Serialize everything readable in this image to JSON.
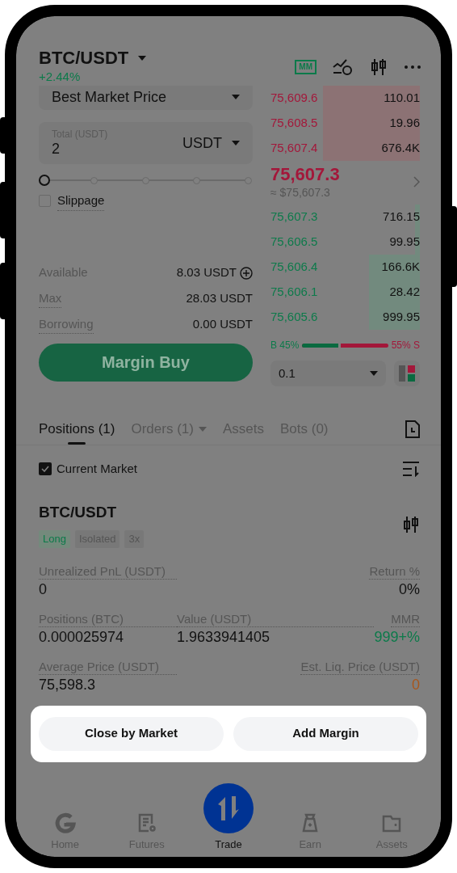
{
  "header": {
    "pair": "BTC/USDT",
    "change": "+2.44%",
    "mm_badge": "MM"
  },
  "order_form": {
    "price_type": "Best Market Price",
    "total": {
      "label": "Total (USDT)",
      "value": "2",
      "unit": "USDT"
    },
    "slider": {
      "level": 0
    },
    "slippage": {
      "label": "Slippage",
      "checked": false
    },
    "stats": [
      {
        "label": "Available",
        "value": "8.03 USDT",
        "kind": "add"
      },
      {
        "label": "Max",
        "value": "28.03 USDT",
        "kind": "plain"
      },
      {
        "label": "Borrowing",
        "value": "0.00 USDT",
        "kind": "plain"
      }
    ],
    "submit": "Margin Buy"
  },
  "order_book": {
    "rows": [
      {
        "price": "75,609.6",
        "amount": "110.01"
      },
      {
        "price": "75,608.5",
        "amount": "19.96"
      },
      {
        "price": "75,607.4",
        "amount": "676.4K"
      }
    ],
    "last_price": "75,607.3",
    "approx": "≈ $75,607.3",
    "bids": [
      {
        "price": "75,607.3",
        "amount": "716.15"
      },
      {
        "price": "75,606.5",
        "amount": "99.95"
      },
      {
        "price": "75,606.4",
        "amount": "166.6K"
      },
      {
        "price": "75,606.1",
        "amount": "28.42"
      },
      {
        "price": "75,605.6",
        "amount": "999.95"
      }
    ],
    "ratio": {
      "buy_label": "B 45%",
      "sell_label": "55% S",
      "level": 0.45
    },
    "precision": "0.1"
  },
  "tabs": [
    {
      "label": "Positions (1)",
      "selected": true,
      "dropdown": false
    },
    {
      "label": "Orders (1)",
      "selected": false,
      "dropdown": true
    },
    {
      "label": "Assets",
      "selected": false,
      "dropdown": false
    },
    {
      "label": "Bots (0)",
      "selected": false,
      "dropdown": false
    }
  ],
  "filter": {
    "label": "Current Market",
    "checked": true
  },
  "position": {
    "pair": "BTC/USDT",
    "tags": [
      {
        "label": "Long",
        "kind": "side"
      },
      {
        "label": "Isolated",
        "kind": "plain"
      },
      {
        "label": "3x",
        "kind": "plain"
      }
    ],
    "fields": [
      [
        {
          "label": "Unrealized PnL (USDT)",
          "value": "0",
          "kind": "plain"
        },
        {
          "label": "Return %",
          "value": "0%",
          "kind": "plain"
        }
      ],
      [
        {
          "label": "Positions (BTC)",
          "value": "0.000025974",
          "kind": "plain"
        },
        {
          "label": "Value (USDT)",
          "value": "1.9633941405",
          "kind": "plain"
        },
        {
          "label": "MMR",
          "value": "999+%",
          "kind": "positive"
        }
      ],
      [
        {
          "label": "Average Price (USDT)",
          "value": "75,598.3",
          "kind": "plain"
        },
        {
          "label": "Est. Liq. Price (USDT)",
          "value": "0",
          "kind": "warning"
        }
      ]
    ]
  },
  "actions": [
    "Close by Market",
    "Add Margin"
  ],
  "nav": [
    {
      "label": "Home",
      "selected": false
    },
    {
      "label": "Futures",
      "selected": false
    },
    {
      "label": "Trade",
      "selected": true
    },
    {
      "label": "Earn",
      "selected": false
    },
    {
      "label": "Assets",
      "selected": false
    }
  ]
}
